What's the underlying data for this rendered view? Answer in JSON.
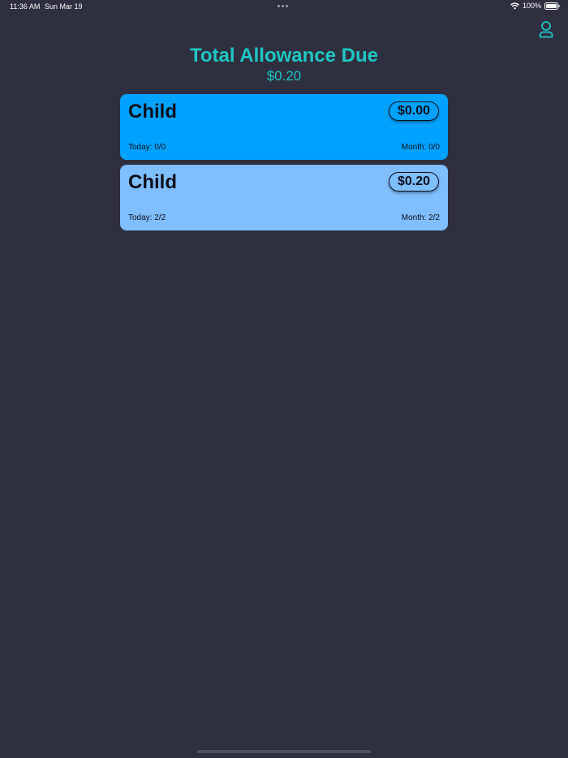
{
  "status_bar": {
    "time": "11:36 AM",
    "date": "Sun Mar 19",
    "battery": "100%"
  },
  "header": {
    "title": "Total Allowance Due",
    "total": "$0.20"
  },
  "children": [
    {
      "name": "Child",
      "amount": "$0.00",
      "today": "Today: 0/0",
      "month": "Month: 0/0",
      "color": "#00a2ff"
    },
    {
      "name": "Child",
      "amount": "$0.20",
      "today": "Today: 2/2",
      "month": "Month: 2/2",
      "color": "#7fbeff"
    }
  ],
  "colors": {
    "background": "#2e3040",
    "accent": "#1fc6c3"
  },
  "icons": {
    "profile": "person-icon",
    "wifi": "wifi-icon",
    "battery": "battery-icon"
  }
}
